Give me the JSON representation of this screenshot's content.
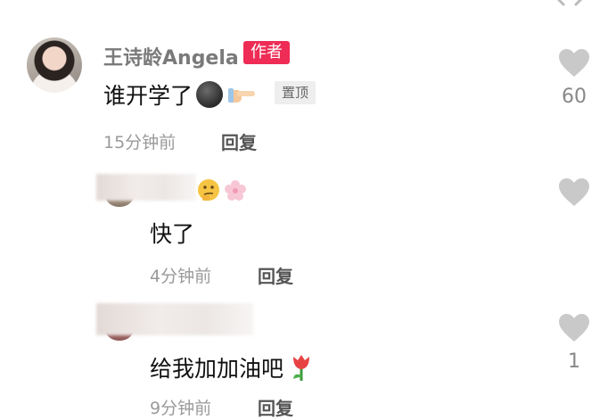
{
  "comments": [
    {
      "username": "王诗龄Angela",
      "badge": "作者",
      "text": "谁开学了",
      "pinned_label": "置顶",
      "time": "15分钟前",
      "reply_label": "回复",
      "likes": "60"
    },
    {
      "text": "快了",
      "time": "4分钟前",
      "reply_label": "回复",
      "likes": ""
    },
    {
      "text": "给我加加油吧",
      "time": "9分钟前",
      "reply_label": "回复",
      "likes": "1"
    }
  ],
  "icons": [
    "heart-icon",
    "moon-emoji",
    "pointing-right-emoji",
    "thinking-emoji",
    "cherry-blossom-emoji",
    "tulip-emoji"
  ]
}
